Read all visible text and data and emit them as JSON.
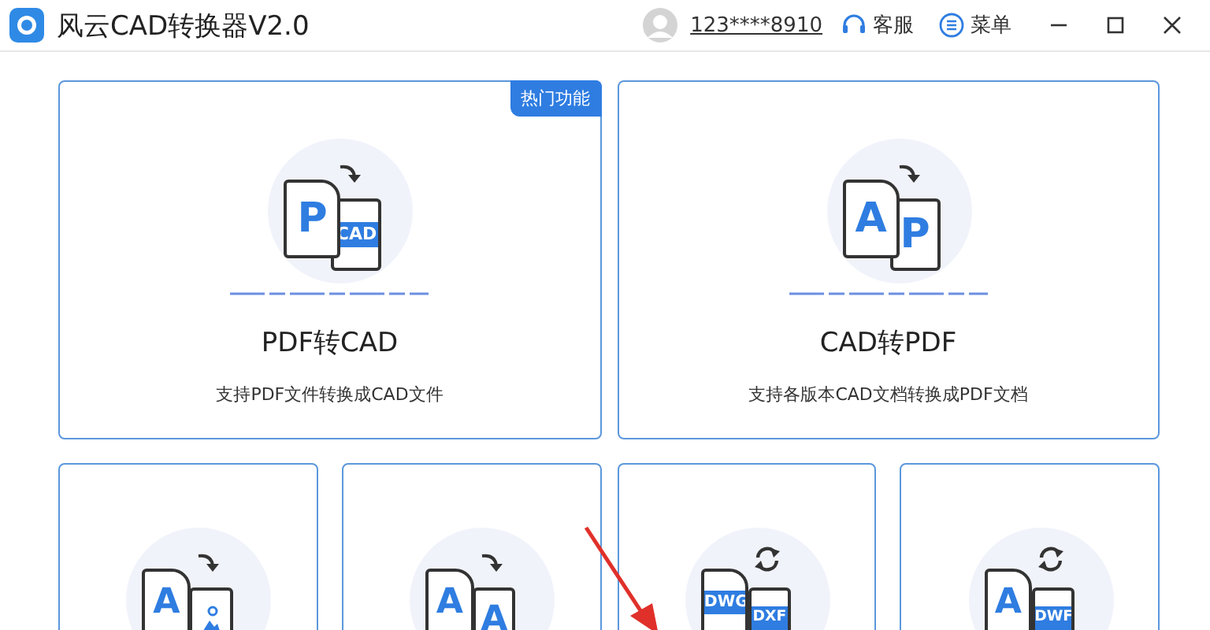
{
  "window": {
    "title": "风云CAD转换器V2.0",
    "account": "123****8910",
    "support": "客服",
    "menu": "菜单"
  },
  "featured": [
    {
      "title": "PDF转CAD",
      "description": "支持PDF文件转换成CAD文件",
      "badge": "热门功能",
      "icon": {
        "kind": "turn",
        "front": {
          "kind": "letter",
          "text": "P"
        },
        "back": {
          "kind": "band",
          "text": "CAD"
        }
      }
    },
    {
      "title": "CAD转PDF",
      "description": "支持各版本CAD文档转换成PDF文档",
      "icon": {
        "kind": "turn",
        "front": {
          "kind": "letter",
          "text": "A"
        },
        "back": {
          "kind": "letter",
          "text": "P"
        }
      }
    }
  ],
  "tools": [
    {
      "icon": {
        "kind": "turn",
        "front": {
          "kind": "letter",
          "text": "A"
        },
        "back": {
          "kind": "image"
        }
      }
    },
    {
      "icon": {
        "kind": "turn",
        "front": {
          "kind": "letter",
          "text": "A"
        },
        "back": {
          "kind": "letter",
          "text": "A"
        }
      }
    },
    {
      "icon": {
        "kind": "sync",
        "front": {
          "kind": "band",
          "text": "DWG"
        },
        "back": {
          "kind": "band",
          "text": "DXF"
        }
      }
    },
    {
      "icon": {
        "kind": "sync",
        "front": {
          "kind": "letter",
          "text": "A"
        },
        "back": {
          "kind": "band",
          "text": "DWF"
        }
      }
    }
  ]
}
